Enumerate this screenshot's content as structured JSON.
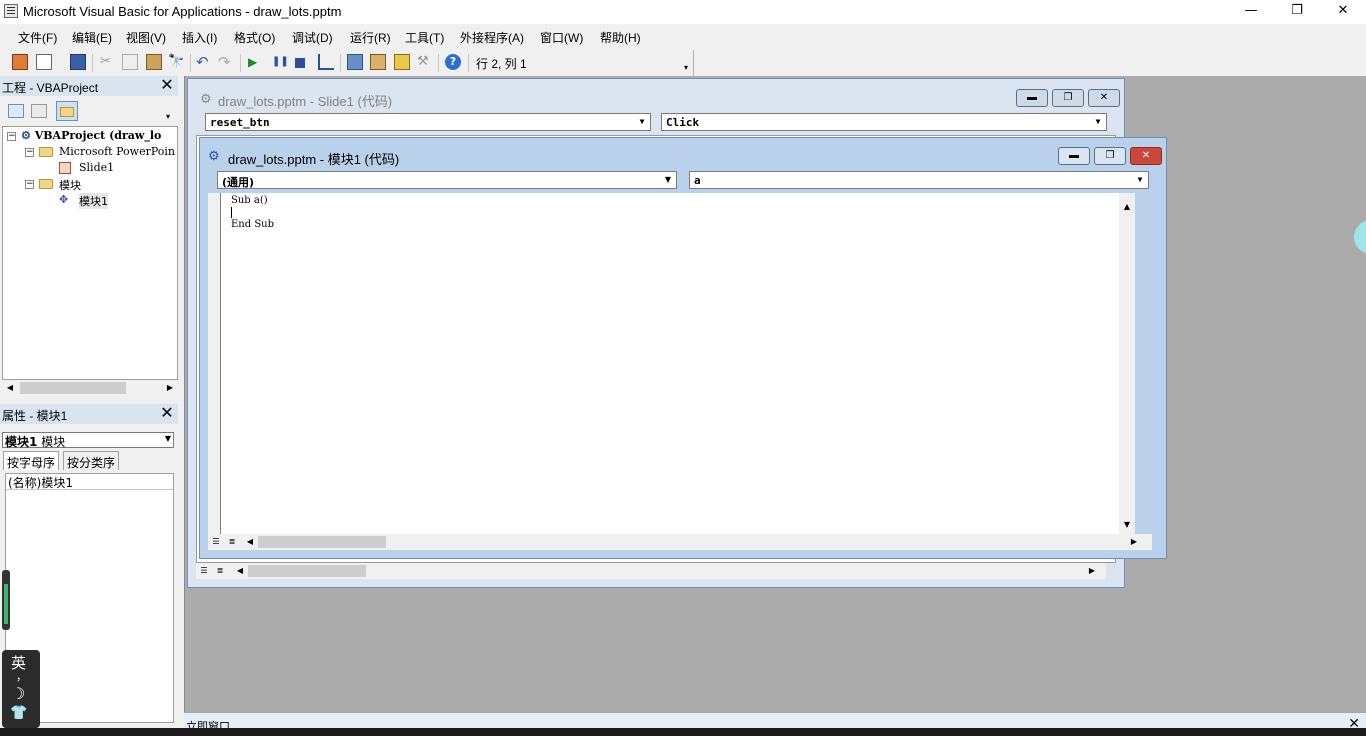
{
  "window": {
    "title": "Microsoft Visual Basic for Applications - draw_lots.pptm",
    "minimize_glyph": "—",
    "restore_glyph": "❐",
    "close_glyph": "✕"
  },
  "menu": [
    "文件(F)",
    "编辑(E)",
    "视图(V)",
    "插入(I)",
    "格式(O)",
    "调试(D)",
    "运行(R)",
    "工具(T)",
    "外接程序(A)",
    "窗口(W)",
    "帮助(H)"
  ],
  "toolbar": {
    "status": "行 2, 列 1"
  },
  "project": {
    "title": "工程 - VBAProject",
    "root": "VBAProject (draw_lo",
    "group1": "Microsoft PowerPoin",
    "slide": "Slide1",
    "group2": "模块",
    "module": "模块1"
  },
  "properties": {
    "title": "属性 - 模块1",
    "object_name": "模块1",
    "object_type": "模块",
    "tab_alpha": "按字母序",
    "tab_cat": "按分类序",
    "row_name_label": "(名称)",
    "row_name_value": "模块1"
  },
  "slide_window": {
    "title": "draw_lots.pptm - Slide1 (代码)",
    "object_combo": "reset_btn",
    "proc_combo": "Click"
  },
  "module_window": {
    "title": "draw_lots.pptm - 模块1 (代码)",
    "object_combo": "(通用)",
    "proc_combo": "a",
    "code": [
      "Sub a()",
      "",
      "End Sub"
    ]
  },
  "immediate": {
    "title": "立即窗口"
  },
  "ime": {
    "lang": "英",
    "punct": "，",
    "moon": "☽",
    "shirt": "👕"
  },
  "colors": {
    "accent_blue": "#6f8fb5",
    "close_red": "#c9483b"
  }
}
